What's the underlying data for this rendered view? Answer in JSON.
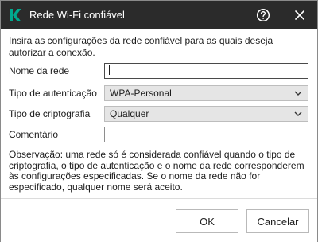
{
  "window": {
    "title": "Rede Wi-Fi confiável",
    "logo_icon": "kaspersky-k-logo",
    "accent_color": "#00a88e",
    "help_icon": "help-question-icon",
    "close_icon": "close-x-icon"
  },
  "form": {
    "intro": "Insira as configurações da rede confiável para as quais deseja autorizar a conexão.",
    "network_name": {
      "label": "Nome da rede",
      "value": ""
    },
    "auth_type": {
      "label": "Tipo de autenticação",
      "value": "WPA-Personal"
    },
    "encryption_type": {
      "label": "Tipo de criptografia",
      "value": "Qualquer"
    },
    "comment": {
      "label": "Comentário",
      "value": ""
    }
  },
  "note": "Observação: uma rede só é considerada confiável quando o tipo de criptografia, o tipo de autenticação e o nome da rede corresponderem às configurações especificadas. Se o nome da rede não for especificado, qualquer nome será aceito.",
  "footer": {
    "ok_label": "OK",
    "cancel_label": "Cancelar"
  }
}
